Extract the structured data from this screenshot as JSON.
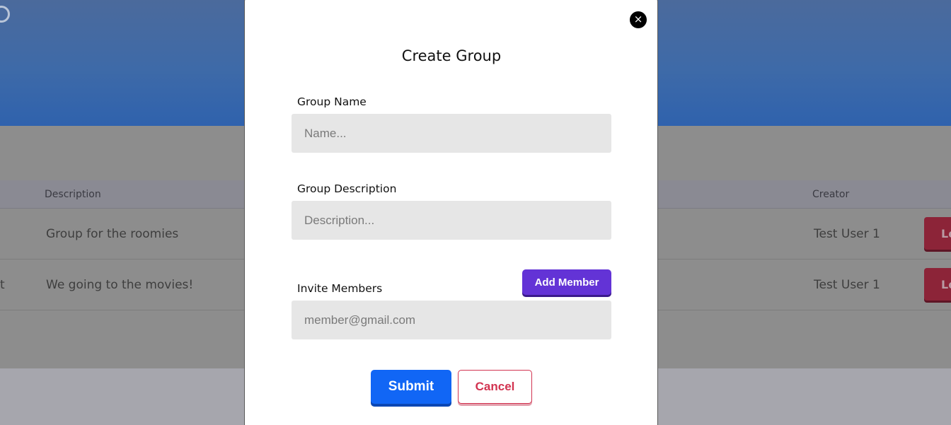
{
  "background": {
    "table": {
      "headers": {
        "description": "Description",
        "creator": "Creator"
      },
      "rows": [
        {
          "name_fragment": "",
          "description": "Group for the roomies",
          "creator": "Test User 1",
          "action_fragment": "Le"
        },
        {
          "name_fragment": "t",
          "description": "We going to the movies!",
          "creator": "Test User 1",
          "action_fragment": "Le"
        }
      ]
    }
  },
  "modal": {
    "close_label": "×",
    "title": "Create Group",
    "group_name": {
      "label": "Group Name",
      "placeholder": "Name...",
      "value": ""
    },
    "group_description": {
      "label": "Group Description",
      "placeholder": "Description...",
      "value": ""
    },
    "invite_members": {
      "label": "Invite Members",
      "placeholder": "member@gmail.com",
      "value": "",
      "add_button_label": "Add Member"
    },
    "submit_label": "Submit",
    "cancel_label": "Cancel"
  },
  "colors": {
    "header_blue": "#3e6aa8",
    "add_member_purple": "#6333d6",
    "submit_blue": "#1166f5",
    "cancel_red": "#d23350",
    "leave_red": "#8c2438"
  }
}
